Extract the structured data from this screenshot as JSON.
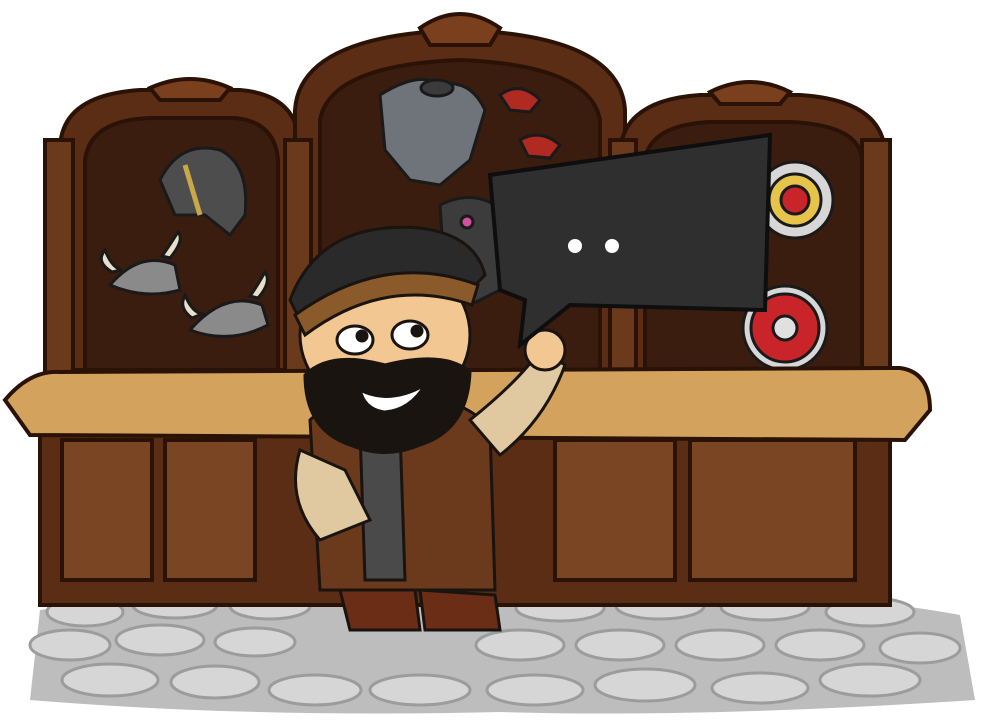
{
  "scene": {
    "name": "blacksmith-shop",
    "speech_bubble": {
      "text": ""
    },
    "colors": {
      "wood_dark": "#4a2511",
      "wood_mid": "#6b3a1c",
      "wood_light": "#c79a57",
      "counter_top": "#d3a35e",
      "panel_back": "#3a1d0e",
      "stone": "#cfcfcf",
      "stone_edge": "#9c9c9c",
      "bubble": "#2f2f2f",
      "beard": "#1a1411",
      "skin": "#f2c791",
      "shield_red": "#c8242a",
      "metal": "#7a7f85"
    },
    "items": [
      "helmet",
      "horned-helmet",
      "horned-helmet",
      "chest-armor",
      "shoulder-pad",
      "shoulder-pad",
      "shield",
      "shield"
    ]
  }
}
